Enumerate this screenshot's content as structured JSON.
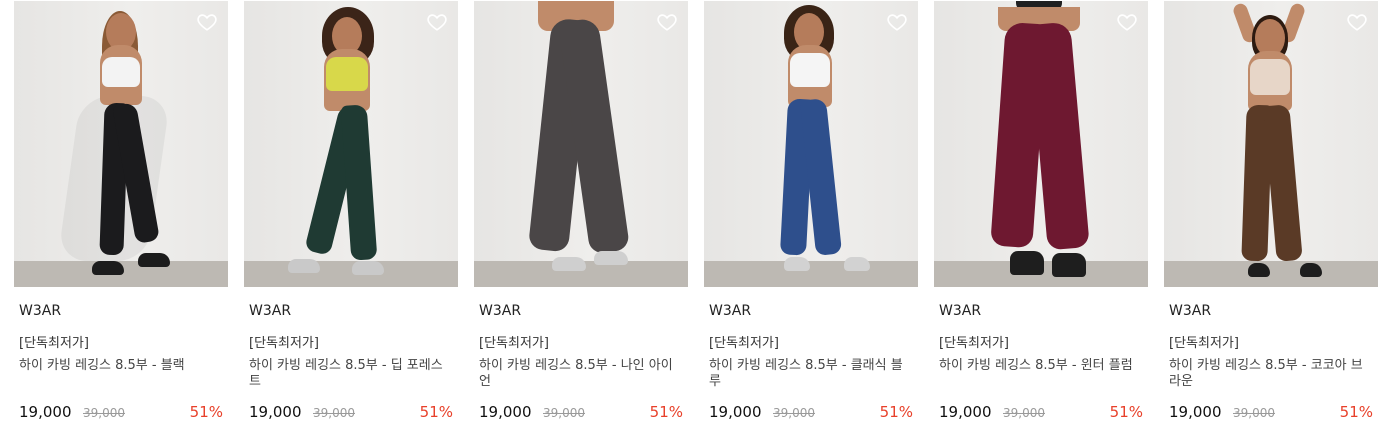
{
  "products": [
    {
      "brand": "W3AR",
      "badge": "[단독최저가]",
      "name": "하이 카빙 레깅스 8.5부 - 블랙",
      "price": "19,000",
      "original_price": "39,000",
      "discount": "51%",
      "legging_color": "#1b1b1d",
      "top_color": "#f3f3f3",
      "hair_color": "#8a5a36",
      "shoe_color": "#1c1c1c"
    },
    {
      "brand": "W3AR",
      "badge": "[단독최저가]",
      "name": "하이 카빙 레깅스 8.5부 - 딥 포레스트",
      "price": "19,000",
      "original_price": "39,000",
      "discount": "51%",
      "legging_color": "#1f3a33",
      "top_color": "#d8d84a",
      "hair_color": "#3b2418",
      "shoe_color": "#c9c9c9"
    },
    {
      "brand": "W3AR",
      "badge": "[단독최저가]",
      "name": "하이 카빙 레깅스 8.5부 - 나인 아이언",
      "price": "19,000",
      "original_price": "39,000",
      "discount": "51%",
      "legging_color": "#4a4647",
      "top_color": "#4a4647",
      "hair_color": "#4a4647",
      "shoe_color": "#cfcfcf"
    },
    {
      "brand": "W3AR",
      "badge": "[단독최저가]",
      "name": "하이 카빙 레깅스 8.5부 - 클래식 블루",
      "price": "19,000",
      "original_price": "39,000",
      "discount": "51%",
      "legging_color": "#2e4f8c",
      "top_color": "#f5f5f5",
      "hair_color": "#3a2416",
      "shoe_color": "#d2d2d2"
    },
    {
      "brand": "W3AR",
      "badge": "[단독최저가]",
      "name": "하이 카빙 레깅스 8.5부 - 윈터 플럼",
      "price": "19,000",
      "original_price": "39,000",
      "discount": "51%",
      "legging_color": "#6e1830",
      "top_color": "#202020",
      "hair_color": "#202020",
      "shoe_color": "#1e1e1e"
    },
    {
      "brand": "W3AR",
      "badge": "[단독최저가]",
      "name": "하이 카빙 레깅스 8.5부 - 코코아 브라운",
      "price": "19,000",
      "original_price": "39,000",
      "discount": "51%",
      "legging_color": "#5a3a26",
      "top_color": "#e7d6c8",
      "hair_color": "#2d1a10",
      "shoe_color": "#1d1d1d"
    }
  ],
  "icons": {
    "wishlist": "heart-outline-icon"
  },
  "colors": {
    "discount": "#e8402a",
    "strike_price": "#9a9a9a"
  }
}
